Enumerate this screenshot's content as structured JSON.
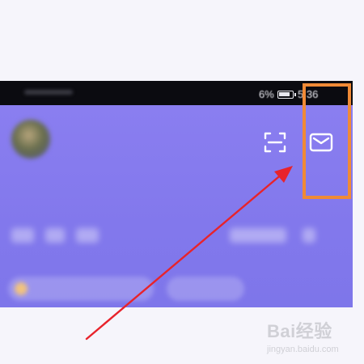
{
  "status_bar": {
    "battery_percent_fragment": "6%",
    "time_fragment": "5 36"
  },
  "header": {
    "icons": [
      "avatar",
      "scan-icon",
      "mail-icon"
    ]
  },
  "annotation": {
    "highlight_color": "#f08a36",
    "arrow_color": "#e8232b"
  },
  "watermark": {
    "logo": "Bai经验",
    "url": "jingyan.baidu.com"
  }
}
